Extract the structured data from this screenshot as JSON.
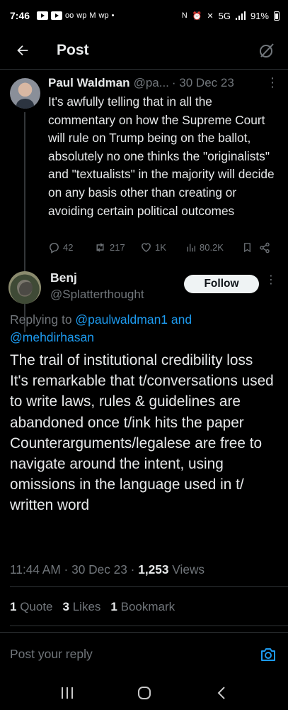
{
  "status_bar": {
    "time": "7:46",
    "network": "5G",
    "battery": "91%"
  },
  "header": {
    "title": "Post"
  },
  "parent_tweet": {
    "author_name": "Paul Waldman",
    "author_handle": "@pa...",
    "date": "· 30 Dec 23",
    "text": "It's awfully telling that in all the commentary on how the Supreme Court will rule on Trump being on the ballot, absolutely no one thinks the \"originalists\" and \"textualists\" in the majority will decide on any basis other than creating or avoiding certain political outcomes",
    "replies": "42",
    "reposts": "217",
    "likes": "1K",
    "views": "80.2K"
  },
  "main_tweet": {
    "author_name": "Benj",
    "author_handle": "@Splatterthought",
    "follow_label": "Follow",
    "replying_prefix": "Replying to ",
    "replying_user1": "@paulwaldman1",
    "replying_and": " and",
    "replying_user2": "@mehdirhasan",
    "text": "The trail of institutional credibility loss\nIt's remarkable that t/conversations used to write laws, rules & guidelines are abandoned once t/ink hits the paper\nCounterarguments/legalese are free to navigate around the intent, using omissions in the language used in t/ written word",
    "time": "11:44 AM · 30 Dec 23 · ",
    "views_count": "1,253",
    "views_label": " Views",
    "quotes_count": "1",
    "quotes_label": "Quote",
    "likes_count": "3",
    "likes_label": "Likes",
    "bookmarks_count": "1",
    "bookmarks_label": "Bookmark"
  },
  "reply_bar": {
    "placeholder": "Post your reply"
  },
  "colors": {
    "background": "#000000",
    "text_primary": "#e7e9ea",
    "text_secondary": "#71767b",
    "link": "#1d9bf0",
    "divider": "#2f3336"
  }
}
